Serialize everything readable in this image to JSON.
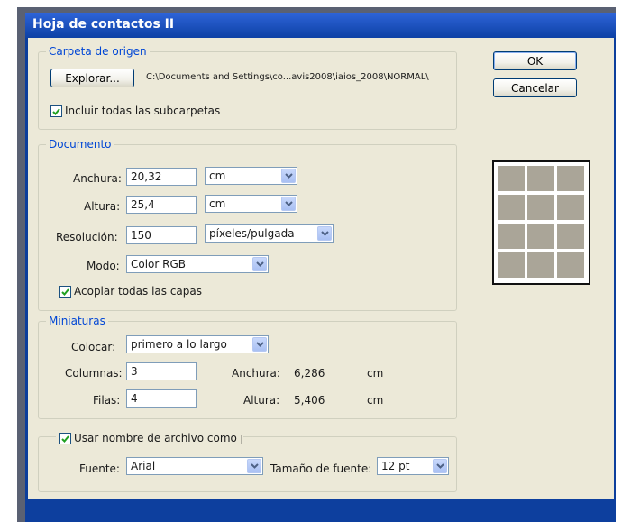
{
  "window": {
    "title": "Hoja de contactos II"
  },
  "buttons": {
    "ok": "OK",
    "cancel": "Cancelar"
  },
  "source_folder": {
    "legend": "Carpeta de origen",
    "browse_label": "Explorar...",
    "path": "C:\\Documents and Settings\\co...avis2008\\iaios_2008\\NORMAL\\",
    "include_subfolders_label": "Incluir todas las subcarpetas",
    "include_subfolders_checked": true
  },
  "document": {
    "legend": "Documento",
    "width_label": "Anchura:",
    "width_value": "20,32",
    "width_unit": "cm",
    "height_label": "Altura:",
    "height_value": "25,4",
    "height_unit": "cm",
    "resolution_label": "Resolución:",
    "resolution_value": "150",
    "resolution_unit": "píxeles/pulgada",
    "mode_label": "Modo:",
    "mode_value": "Color RGB",
    "flatten_label": "Acoplar todas las capas",
    "flatten_checked": true
  },
  "thumbnails": {
    "legend": "Miniaturas",
    "place_label": "Colocar:",
    "place_value": "primero a lo largo",
    "columns_label": "Columnas:",
    "columns_value": "3",
    "rows_label": "Filas:",
    "rows_value": "4",
    "thumb_width_label": "Anchura:",
    "thumb_width_value": "6,286",
    "thumb_width_unit": "cm",
    "thumb_height_label": "Altura:",
    "thumb_height_value": "5,406",
    "thumb_height_unit": "cm"
  },
  "caption": {
    "use_filename_label": "Usar nombre de archivo como p",
    "use_filename_checked": true,
    "font_label": "Fuente:",
    "font_value": "Arial",
    "font_size_label": "Tamaño de fuente:",
    "font_size_value": "12 pt"
  },
  "preview": {
    "columns": 3,
    "rows": 4
  },
  "icons": {
    "dropdown": "chevron-down-icon",
    "check": "checkmark-icon"
  },
  "colors": {
    "title_bar": "#0d41a5",
    "dialog_bg": "#ece9d8",
    "legend_text": "#0046d5",
    "thumbnail_cell": "#aaa598"
  }
}
